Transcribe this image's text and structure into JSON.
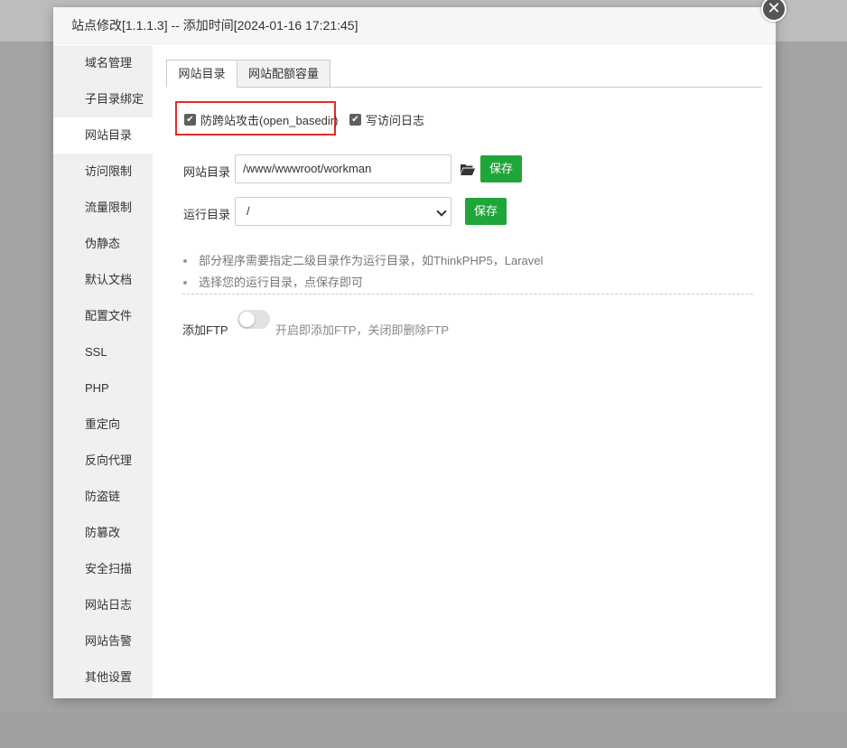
{
  "dialog": {
    "title": "站点修改[1.1.1.3] -- 添加时间[2024-01-16 17:21:45]",
    "close_glyph": "✕"
  },
  "sidebar": {
    "items": [
      {
        "label": "域名管理"
      },
      {
        "label": "子目录绑定"
      },
      {
        "label": "网站目录",
        "active": true
      },
      {
        "label": "访问限制"
      },
      {
        "label": "流量限制"
      },
      {
        "label": "伪静态"
      },
      {
        "label": "默认文档"
      },
      {
        "label": "配置文件"
      },
      {
        "label": "SSL"
      },
      {
        "label": "PHP"
      },
      {
        "label": "重定向"
      },
      {
        "label": "反向代理"
      },
      {
        "label": "防盗链"
      },
      {
        "label": "防篡改"
      },
      {
        "label": "安全扫描"
      },
      {
        "label": "网站日志"
      },
      {
        "label": "网站告警"
      },
      {
        "label": "其他设置"
      }
    ]
  },
  "tabs": [
    {
      "label": "网站目录",
      "active": true
    },
    {
      "label": "网站配额容量",
      "active": false
    }
  ],
  "options": {
    "anti_cross_site": {
      "label": "防跨站攻击(open_basedir)",
      "checked": true
    },
    "access_log": {
      "label": "写访问日志",
      "checked": true
    }
  },
  "site_dir": {
    "label": "网站目录",
    "value": "/www/wwwroot/workman",
    "save_label": "保存"
  },
  "run_dir": {
    "label": "运行目录",
    "selected": "/",
    "save_label": "保存"
  },
  "tips": [
    "部分程序需要指定二级目录作为运行目录，如ThinkPHP5，Laravel",
    "选择您的运行目录，点保存即可"
  ],
  "ftp": {
    "label": "添加FTP",
    "enabled": false,
    "description": "开启即添加FTP，关闭即删除FTP"
  },
  "colors": {
    "accent_green": "#20a53a",
    "highlight_red": "#e02b2b"
  }
}
